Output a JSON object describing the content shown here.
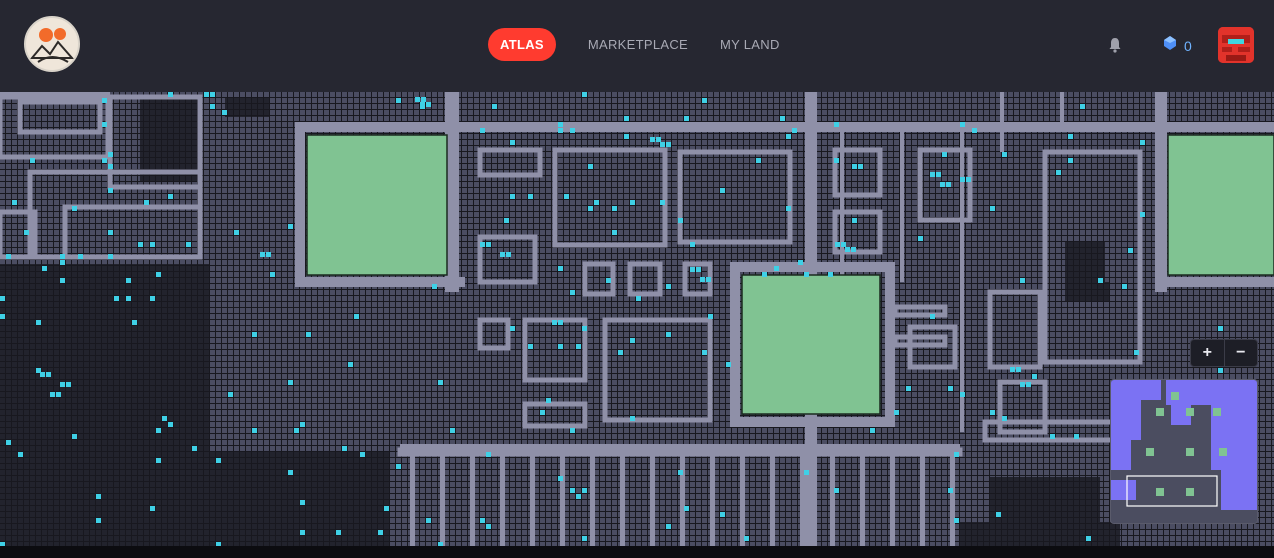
{
  "header": {
    "nav": [
      {
        "label": "ATLAS",
        "active": true
      },
      {
        "label": "MARKETPLACE",
        "active": false
      },
      {
        "label": "MY LAND",
        "active": false
      }
    ],
    "wallet_count": "0",
    "icons": {
      "logo": "decentraland-logo",
      "notifications": "bell-icon",
      "wallet": "mana-icon",
      "avatar": "avatar"
    }
  },
  "map": {
    "colors": {
      "background": "#15151c",
      "parcel": "#4b4d62",
      "owned": "#22232d",
      "road": "#8f90a8",
      "plaza": "#80c392",
      "on_sale": "#3fd0e6"
    }
  },
  "zoom": {
    "in_label": "+",
    "out_label": "−"
  },
  "minimap": {
    "colors": {
      "base": "#4b4d60",
      "district": "#7b72f3",
      "plaza": "#80c392",
      "viewport": "#ffffff"
    }
  }
}
